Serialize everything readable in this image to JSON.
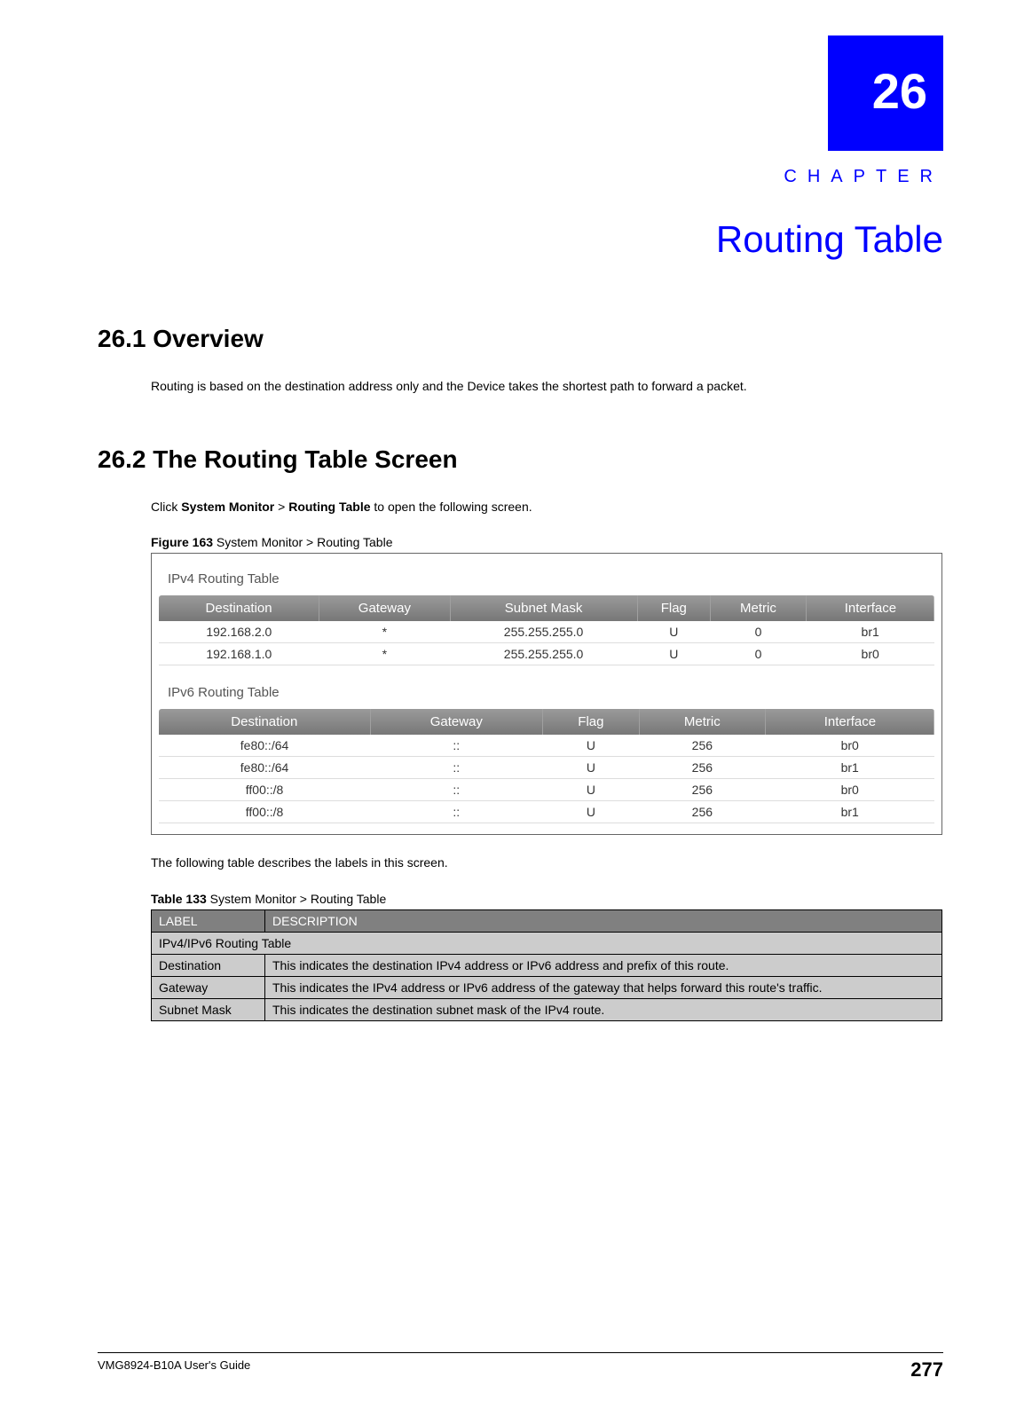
{
  "chapter": {
    "number": "26",
    "word": "CHAPTER",
    "title": "Routing Table"
  },
  "section1": {
    "heading": "26.1  Overview",
    "body": "Routing is based on the destination address only and the Device takes the shortest path to forward a packet."
  },
  "section2": {
    "heading": "26.2  The Routing Table Screen",
    "body_prefix": "Click ",
    "body_bold1": "System Monitor",
    "body_mid": " > ",
    "body_bold2": "Routing Table",
    "body_suffix": " to open the following screen."
  },
  "figure": {
    "label_bold": "Figure 163",
    "label_rest": "   System Monitor > Routing Table"
  },
  "screenshot": {
    "ipv4_title": "IPv4 Routing Table",
    "ipv4_headers": [
      "Destination",
      "Gateway",
      "Subnet Mask",
      "Flag",
      "Metric",
      "Interface"
    ],
    "ipv4_rows": [
      [
        "192.168.2.0",
        "*",
        "255.255.255.0",
        "U",
        "0",
        "br1"
      ],
      [
        "192.168.1.0",
        "*",
        "255.255.255.0",
        "U",
        "0",
        "br0"
      ]
    ],
    "ipv6_title": "IPv6 Routing Table",
    "ipv6_headers": [
      "Destination",
      "Gateway",
      "Flag",
      "Metric",
      "Interface"
    ],
    "ipv6_rows": [
      [
        "fe80::/64",
        "::",
        "U",
        "256",
        "br0"
      ],
      [
        "fe80::/64",
        "::",
        "U",
        "256",
        "br1"
      ],
      [
        "ff00::/8",
        "::",
        "U",
        "256",
        "br0"
      ],
      [
        "ff00::/8",
        "::",
        "U",
        "256",
        "br1"
      ]
    ]
  },
  "post_figure_text": "The following table describes the labels in this screen.",
  "table_caption": {
    "bold": "Table 133",
    "rest": "   System Monitor > Routing Table"
  },
  "desc_table": {
    "headers": [
      "LABEL",
      "DESCRIPTION"
    ],
    "rows": [
      {
        "span": true,
        "text": "IPv4/IPv6 Routing Table"
      },
      {
        "label": "Destination",
        "desc": "This indicates the destination IPv4 address or IPv6 address and prefix of this route."
      },
      {
        "label": "Gateway",
        "desc": "This indicates the IPv4 address or IPv6 address of the gateway that helps forward this route's traffic."
      },
      {
        "label": "Subnet Mask",
        "desc": "This indicates the destination subnet mask of the IPv4 route."
      }
    ]
  },
  "footer": {
    "left": "VMG8924-B10A User's Guide",
    "right": "277"
  }
}
